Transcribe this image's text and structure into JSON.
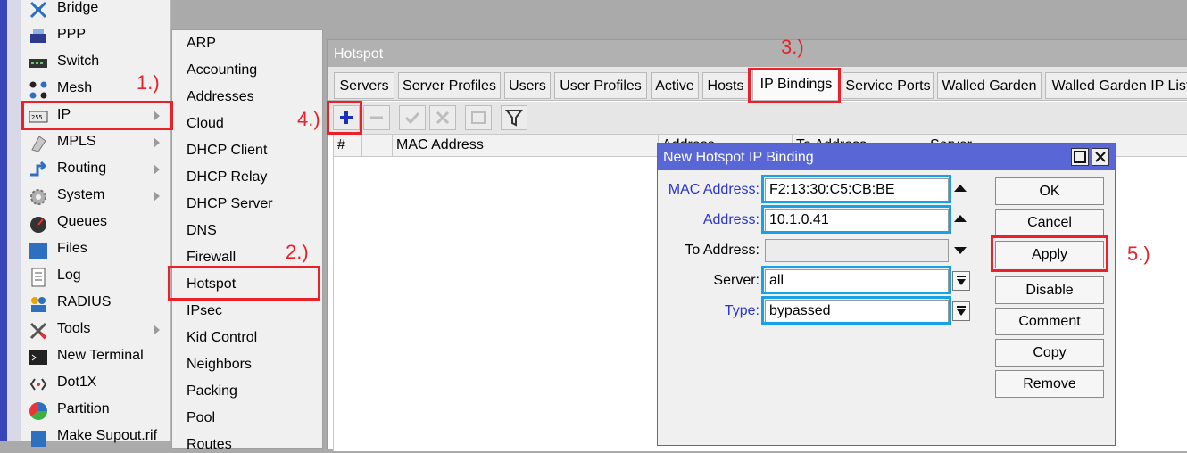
{
  "main_menu": {
    "items": [
      {
        "label": "Bridge",
        "icon": "bridge-icon",
        "has_sub": false
      },
      {
        "label": "PPP",
        "icon": "ppp-icon",
        "has_sub": false
      },
      {
        "label": "Switch",
        "icon": "switch-icon",
        "has_sub": false
      },
      {
        "label": "Mesh",
        "icon": "mesh-icon",
        "has_sub": false
      },
      {
        "label": "IP",
        "icon": "ip-icon",
        "has_sub": true
      },
      {
        "label": "MPLS",
        "icon": "mpls-icon",
        "has_sub": true
      },
      {
        "label": "Routing",
        "icon": "routing-icon",
        "has_sub": true
      },
      {
        "label": "System",
        "icon": "system-gear-icon",
        "has_sub": true
      },
      {
        "label": "Queues",
        "icon": "queues-icon",
        "has_sub": false
      },
      {
        "label": "Files",
        "icon": "folder-icon",
        "has_sub": false
      },
      {
        "label": "Log",
        "icon": "log-icon",
        "has_sub": false
      },
      {
        "label": "RADIUS",
        "icon": "radius-icon",
        "has_sub": false
      },
      {
        "label": "Tools",
        "icon": "tools-icon",
        "has_sub": true
      },
      {
        "label": "New Terminal",
        "icon": "terminal-icon",
        "has_sub": false
      },
      {
        "label": "Dot1X",
        "icon": "dot1x-icon",
        "has_sub": false
      },
      {
        "label": "Partition",
        "icon": "partition-icon",
        "has_sub": false
      },
      {
        "label": "Make Supout.rif",
        "icon": "supout-icon",
        "has_sub": false
      }
    ]
  },
  "ip_submenu": {
    "items": [
      "ARP",
      "Accounting",
      "Addresses",
      "Cloud",
      "DHCP Client",
      "DHCP Relay",
      "DHCP Server",
      "DNS",
      "Firewall",
      "Hotspot",
      "IPsec",
      "Kid Control",
      "Neighbors",
      "Packing",
      "Pool",
      "Routes"
    ]
  },
  "hotspot_window": {
    "title": "Hotspot",
    "tabs": [
      "Servers",
      "Server Profiles",
      "Users",
      "User Profiles",
      "Active",
      "Hosts",
      "IP Bindings",
      "Service Ports",
      "Walled Garden",
      "Walled Garden IP List"
    ],
    "active_tab": "IP Bindings",
    "columns": [
      "#",
      "",
      "MAC Address",
      "Address",
      "To Address",
      "Server"
    ]
  },
  "dialog": {
    "title": "New Hotspot IP Binding",
    "fields": {
      "mac_address": {
        "label": "MAC Address:",
        "value": "F2:13:30:C5:CB:BE"
      },
      "address": {
        "label": "Address:",
        "value": "10.1.0.41"
      },
      "to_address": {
        "label": "To Address:",
        "value": ""
      },
      "server": {
        "label": "Server:",
        "value": "all"
      },
      "type": {
        "label": "Type:",
        "value": "bypassed"
      }
    },
    "buttons": [
      "OK",
      "Cancel",
      "Apply",
      "Disable",
      "Comment",
      "Copy",
      "Remove"
    ]
  },
  "annotations": {
    "step1": "1.)",
    "step2": "2.)",
    "step3": "3.)",
    "step4": "4.)",
    "step5": "5.)"
  },
  "colors": {
    "annotation_red": "#e8212b",
    "annotation_blue": "#17a2e6",
    "dialog_title_bar": "#5866d6",
    "field_label_blue": "#2b34d1"
  }
}
